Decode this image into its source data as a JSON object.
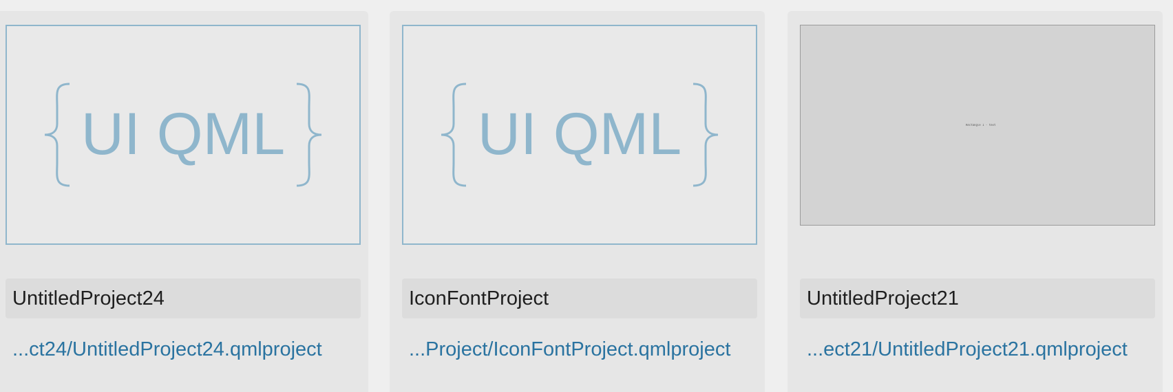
{
  "projects": [
    {
      "name": "UntitledProject24",
      "path": "...ct24/UntitledProject24.qmlproject",
      "thumbnail": "ui-qml-logo"
    },
    {
      "name": "IconFontProject",
      "path": "...Project/IconFontProject.qmlproject",
      "thumbnail": "ui-qml-logo"
    },
    {
      "name": "UntitledProject21",
      "path": "...ect21/UntitledProject21.qmlproject",
      "thumbnail": "blank-preview",
      "thumbnail_text": "Rectangle 1 · text"
    }
  ],
  "logo": {
    "text": "UI QML",
    "color": "#8fb6cc"
  },
  "colors": {
    "link": "#2a73a0",
    "card_bg": "#e6e6e6",
    "field_bg": "#dcdcdc"
  }
}
